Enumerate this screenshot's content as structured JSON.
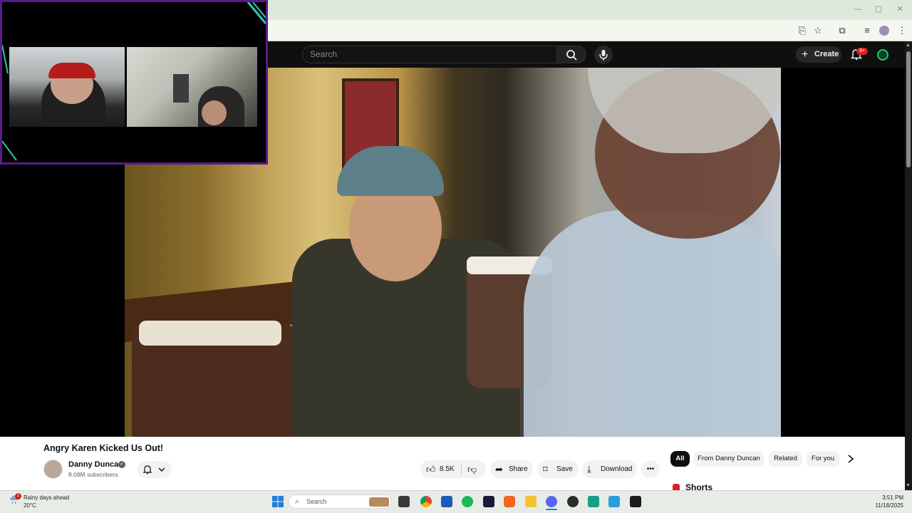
{
  "youtube": {
    "search_placeholder": "Search",
    "create_label": "Create",
    "notifications_count": "9+"
  },
  "video": {
    "title": "Angry Karen Kicked Us Out!",
    "channel_name": "Danny Duncan",
    "subscribers": "8.08M subscribers",
    "likes": "8.5K",
    "share_label": "Share",
    "save_label": "Save",
    "download_label": "Download"
  },
  "sidebar": {
    "chips": [
      "All",
      "From Danny Duncan",
      "Related",
      "For you"
    ],
    "shorts_label": "Shorts"
  },
  "taskbar": {
    "weather_title": "Rainy days ahead",
    "weather_temp": "20°C",
    "weather_badge": "1",
    "search_label": "Search",
    "time": "3:51 PM",
    "date": "11/18/2025"
  },
  "colors": {
    "accent_red": "#e02020",
    "overlay_border": "#5a1a8a",
    "overlay_teal": "#2ec4b6"
  }
}
